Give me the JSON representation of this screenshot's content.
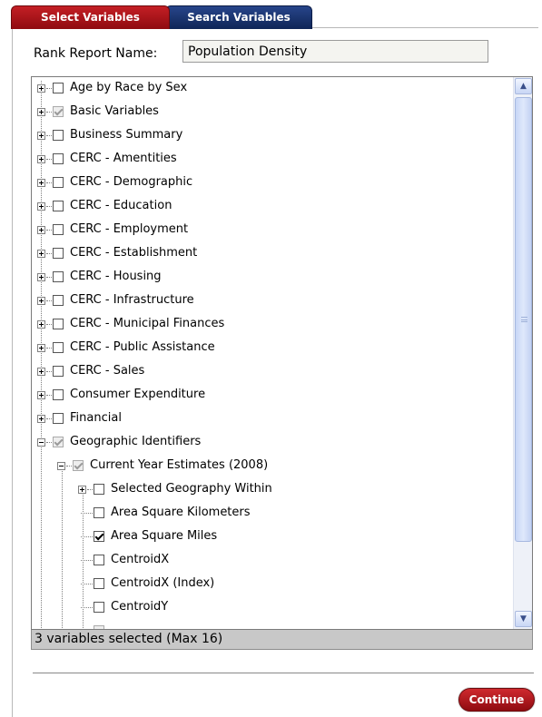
{
  "tabs": [
    {
      "label": "Select Variables",
      "active": true
    },
    {
      "label": "Search Variables",
      "active": false
    }
  ],
  "report": {
    "label": "Rank Report Name:",
    "value": "Population Density"
  },
  "tree": [
    {
      "label": "Age by Race by Sex",
      "level": 0,
      "expander": "plus",
      "check": "none"
    },
    {
      "label": "Basic Variables",
      "level": 0,
      "expander": "plus",
      "check": "grey"
    },
    {
      "label": "Business Summary",
      "level": 0,
      "expander": "plus",
      "check": "none"
    },
    {
      "label": "CERC - Amentities",
      "level": 0,
      "expander": "plus",
      "check": "none"
    },
    {
      "label": "CERC - Demographic",
      "level": 0,
      "expander": "plus",
      "check": "none"
    },
    {
      "label": "CERC - Education",
      "level": 0,
      "expander": "plus",
      "check": "none"
    },
    {
      "label": "CERC - Employment",
      "level": 0,
      "expander": "plus",
      "check": "none"
    },
    {
      "label": "CERC - Establishment",
      "level": 0,
      "expander": "plus",
      "check": "none"
    },
    {
      "label": "CERC - Housing",
      "level": 0,
      "expander": "plus",
      "check": "none"
    },
    {
      "label": "CERC - Infrastructure",
      "level": 0,
      "expander": "plus",
      "check": "none"
    },
    {
      "label": "CERC - Municipal Finances",
      "level": 0,
      "expander": "plus",
      "check": "none"
    },
    {
      "label": "CERC - Public Assistance",
      "level": 0,
      "expander": "plus",
      "check": "none"
    },
    {
      "label": "CERC - Sales",
      "level": 0,
      "expander": "plus",
      "check": "none"
    },
    {
      "label": "Consumer Expenditure",
      "level": 0,
      "expander": "plus",
      "check": "none"
    },
    {
      "label": "Financial",
      "level": 0,
      "expander": "plus",
      "check": "none"
    },
    {
      "label": "Geographic Identifiers",
      "level": 0,
      "expander": "minus",
      "check": "grey"
    },
    {
      "label": "Current Year Estimates (2008)",
      "level": 1,
      "expander": "minus",
      "check": "grey"
    },
    {
      "label": "Selected Geography Within",
      "level": 2,
      "expander": "plus",
      "check": "none"
    },
    {
      "label": "Area Square Kilometers",
      "level": 2,
      "expander": "leaf",
      "check": "none"
    },
    {
      "label": "Area Square Miles",
      "level": 2,
      "expander": "leaf",
      "check": "checked"
    },
    {
      "label": "CentroidX",
      "level": 2,
      "expander": "leaf",
      "check": "none"
    },
    {
      "label": "CentroidX (Index)",
      "level": 2,
      "expander": "leaf",
      "check": "none"
    },
    {
      "label": "CentroidY",
      "level": 2,
      "expander": "leaf",
      "check": "none"
    }
  ],
  "status": "3 variables selected (Max 16)",
  "continue_label": "Continue",
  "icons": {
    "up": "scroll-up-arrow-icon",
    "down": "scroll-down-arrow-icon"
  },
  "colors": {
    "select_tab": "#c41f25",
    "search_tab": "#27458a",
    "continue": "#b3141a",
    "status_bg": "#c8c8c8"
  }
}
